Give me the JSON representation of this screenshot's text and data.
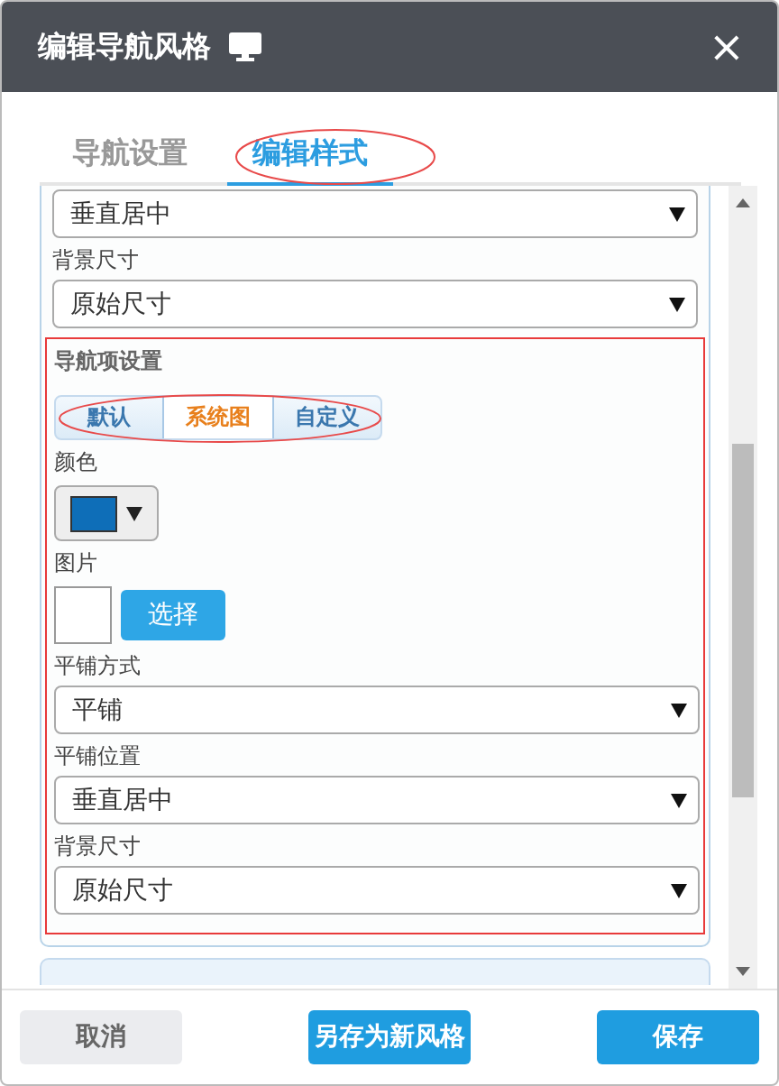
{
  "window": {
    "title": "编辑导航风格",
    "close": "×"
  },
  "tabs": [
    {
      "label": "导航设置",
      "selected": false
    },
    {
      "label": "编辑样式",
      "selected": true
    }
  ],
  "top_fields": [
    {
      "value": "垂直居中"
    },
    {
      "label": "背景尺寸",
      "value": "原始尺寸"
    }
  ],
  "nav_item_settings": {
    "title": "导航项设置",
    "segments": [
      {
        "label": "默认",
        "selected": false
      },
      {
        "label": "系统图",
        "selected": true
      },
      {
        "label": "自定义",
        "selected": false
      }
    ],
    "color_label": "颜色",
    "color": "#0e6eb8",
    "image_label": "图片",
    "choose_button": "选择",
    "fields": [
      {
        "label": "平铺方式",
        "value": "平铺"
      },
      {
        "label": "平铺位置",
        "value": "垂直居中"
      },
      {
        "label": "背景尺寸",
        "value": "原始尺寸"
      }
    ]
  },
  "buttons": [
    {
      "label": "取消",
      "kind": "secondary"
    },
    {
      "label": "另存为新风格",
      "kind": "primary"
    },
    {
      "label": "保存",
      "kind": "primary"
    }
  ]
}
